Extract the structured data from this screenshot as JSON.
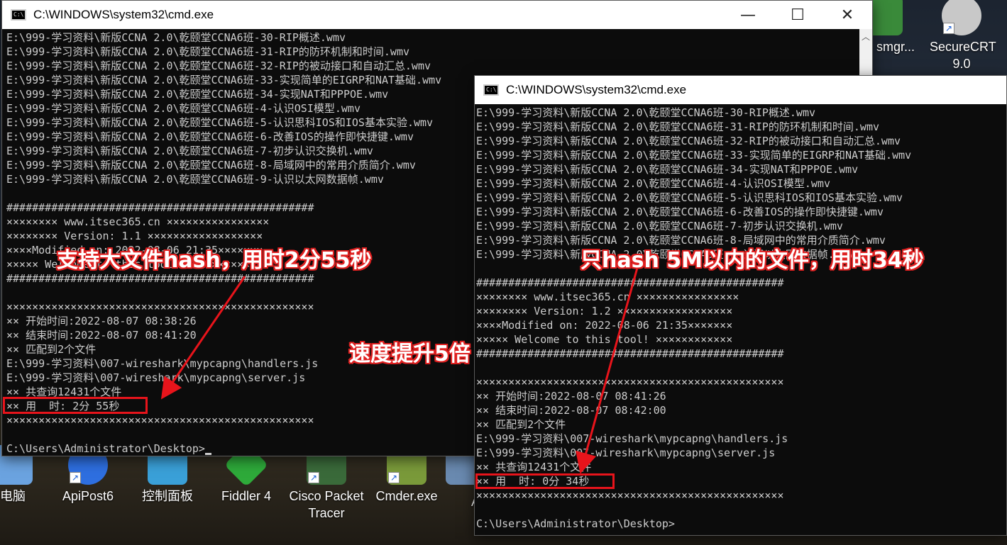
{
  "desktop": {
    "icons": [
      {
        "label": "电脑",
        "color": "#6ba3e0"
      },
      {
        "label": "ApiPost6",
        "color": "#2e6fe0"
      },
      {
        "label": "控制面板",
        "color": "#3aa0d8"
      },
      {
        "label": "Fiddler 4",
        "color": "#2eaa3a"
      },
      {
        "label": "Cisco Packet Tracer",
        "color": "#3a6a3a"
      },
      {
        "label": "Cmder.exe",
        "color": "#7a9a3a"
      },
      {
        "label": "Ap",
        "color": "#6a8ab0"
      },
      {
        "label": "smgr...",
        "color": "#3a8a3a"
      },
      {
        "label": "SecureCRT 9.0",
        "color": "#c8c8c8"
      }
    ]
  },
  "window1": {
    "title": "C:\\WINDOWS\\system32\\cmd.exe",
    "controls": {
      "minimize": "—",
      "maximize": "☐",
      "close": "✕"
    },
    "lines": [
      "E:\\999-学习资料\\新版CCNA 2.0\\乾颐堂CCNA6班-30-RIP概述.wmv",
      "E:\\999-学习资料\\新版CCNA 2.0\\乾颐堂CCNA6班-31-RIP的防环机制和时间.wmv",
      "E:\\999-学习资料\\新版CCNA 2.0\\乾颐堂CCNA6班-32-RIP的被动接口和自动汇总.wmv",
      "E:\\999-学习资料\\新版CCNA 2.0\\乾颐堂CCNA6班-33-实现简单的EIGRP和NAT基础.wmv",
      "E:\\999-学习资料\\新版CCNA 2.0\\乾颐堂CCNA6班-34-实现NAT和PPPOE.wmv",
      "E:\\999-学习资料\\新版CCNA 2.0\\乾颐堂CCNA6班-4-认识OSI模型.wmv",
      "E:\\999-学习资料\\新版CCNA 2.0\\乾颐堂CCNA6班-5-认识思科IOS和IOS基本实验.wmv",
      "E:\\999-学习资料\\新版CCNA 2.0\\乾颐堂CCNA6班-6-改善IOS的操作即快捷键.wmv",
      "E:\\999-学习资料\\新版CCNA 2.0\\乾颐堂CCNA6班-7-初步认识交换机.wmv",
      "E:\\999-学习资料\\新版CCNA 2.0\\乾颐堂CCNA6班-8-局域网中的常用介质简介.wmv",
      "E:\\999-学习资料\\新版CCNA 2.0\\乾颐堂CCNA6班-9-认识以太网数据帧.wmv",
      "",
      "################################################",
      "×××××××× www.itsec365.cn ××××××××××××××××",
      "×××××××× Version: 1.1 ××××××××××××××××××",
      "××××Modified on: 2022-08-06 21:35×××××××",
      "××××× Welcome to this tool! ××××××××××××",
      "################################################",
      "",
      "××××××××××××××××××××××××××××××××××××××××××××××××",
      "×× 开始时间:2022-08-07 08:38:26",
      "×× 结束时间:2022-08-07 08:41:20",
      "×× 匹配到2个文件",
      "E:\\999-学习资料\\007-wireshark\\mypcapng\\handlers.js",
      "E:\\999-学习资料\\007-wireshark\\mypcapng\\server.js",
      "×× 共查询12431个文件",
      "×× 用  时: 2分 55秒",
      "××××××××××××××××××××××××××××××××××××××××××××××××",
      "",
      "C:\\Users\\Administrator\\Desktop>"
    ]
  },
  "window2": {
    "title": "C:\\WINDOWS\\system32\\cmd.exe",
    "lines": [
      "E:\\999-学习资料\\新版CCNA 2.0\\乾颐堂CCNA6班-30-RIP概述.wmv",
      "E:\\999-学习资料\\新版CCNA 2.0\\乾颐堂CCNA6班-31-RIP的防环机制和时间.wmv",
      "E:\\999-学习资料\\新版CCNA 2.0\\乾颐堂CCNA6班-32-RIP的被动接口和自动汇总.wmv",
      "E:\\999-学习资料\\新版CCNA 2.0\\乾颐堂CCNA6班-33-实现简单的EIGRP和NAT基础.wmv",
      "E:\\999-学习资料\\新版CCNA 2.0\\乾颐堂CCNA6班-34-实现NAT和PPPOE.wmv",
      "E:\\999-学习资料\\新版CCNA 2.0\\乾颐堂CCNA6班-4-认识OSI模型.wmv",
      "E:\\999-学习资料\\新版CCNA 2.0\\乾颐堂CCNA6班-5-认识思科IOS和IOS基本实验.wmv",
      "E:\\999-学习资料\\新版CCNA 2.0\\乾颐堂CCNA6班-6-改善IOS的操作即快捷键.wmv",
      "E:\\999-学习资料\\新版CCNA 2.0\\乾颐堂CCNA6班-7-初步认识交换机.wmv",
      "E:\\999-学习资料\\新版CCNA 2.0\\乾颐堂CCNA6班-8-局域网中的常用介质简介.wmv",
      "E:\\999-学习资料\\新版CCNA 2.0\\乾颐堂CCNA6班-9-认识以太网数据帧.wmv",
      "",
      "################################################",
      "×××××××× www.itsec365.cn ××××××××××××××××",
      "×××××××× Version: 1.2 ××××××××××××××××××",
      "××××Modified on: 2022-08-06 21:35×××××××",
      "××××× Welcome to this tool! ××××××××××××",
      "################################################",
      "",
      "××××××××××××××××××××××××××××××××××××××××××××××××",
      "×× 开始时间:2022-08-07 08:41:26",
      "×× 结束时间:2022-08-07 08:42:00",
      "×× 匹配到2个文件",
      "E:\\999-学习资料\\007-wireshark\\mypcapng\\handlers.js",
      "E:\\999-学习资料\\007-wireshark\\mypcapng\\server.js",
      "×× 共查询12431个文件",
      "×× 用  时: 0分 34秒",
      "××××××××××××××××××××××××××××××××××××××××××××××××",
      "",
      "C:\\Users\\Administrator\\Desktop>"
    ]
  },
  "annotations": {
    "left_label": "支持大文件hash，用时2分55秒",
    "right_label": "只hash 5M以内的文件，用时34秒",
    "middle_label": "速度提升5倍",
    "color": "#e8141b"
  }
}
